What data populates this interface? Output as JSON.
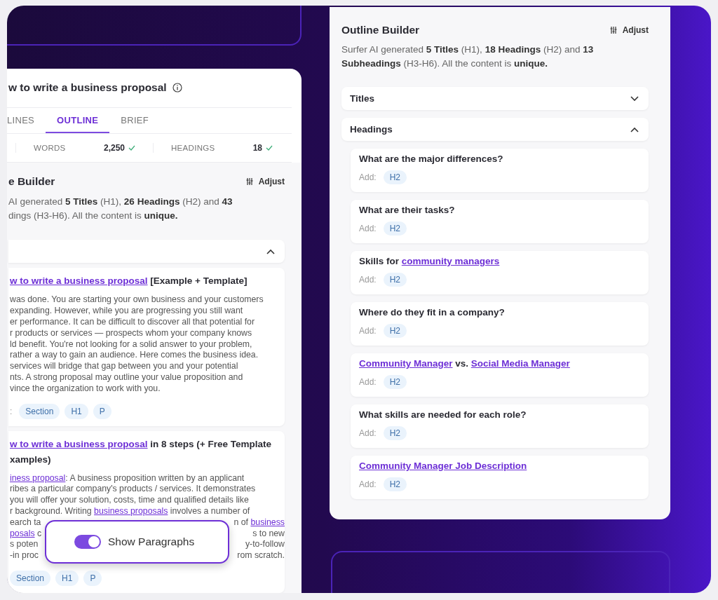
{
  "left_panel": {
    "title": "w to write a business proposal",
    "tabs": [
      {
        "label": "LINES",
        "selected": false
      },
      {
        "label": "OUTLINE",
        "selected": true
      },
      {
        "label": "BRIEF",
        "selected": false
      }
    ],
    "stats": [
      {
        "label": "WORDS",
        "value": "2,250",
        "met": true
      },
      {
        "label": "HEADINGS",
        "value": "18",
        "met": true
      }
    ],
    "builder": {
      "title": "e Builder",
      "action": "Adjust",
      "description_lines": [
        "AI generated **5 Titles** (H1), **26 Headings** (H2) and **43**",
        "dings (H3-H6). All the content is **unique.**"
      ]
    },
    "accordion": {
      "expanded": true
    },
    "sections": [
      {
        "title_lines": [
          [
            {
              "text": "w to write a business proposal",
              "link": true
            },
            {
              "text": " [Example + Template]"
            }
          ]
        ],
        "paragraph": [
          [
            [
              {
                "text": "was done. You are starting your own business and your customers"
              }
            ]
          ],
          [
            [
              {
                "text": "expanding. However, while you are progressing you still want"
              }
            ]
          ],
          [
            [
              {
                "text": "er performance. It can be difficult to discover all that potential for"
              }
            ]
          ],
          [
            [
              {
                "text": "r products or services — prospects whom your company knows"
              }
            ]
          ],
          [
            [
              {
                "text": "ld benefit. You're not looking for a solid answer to your problem,"
              }
            ]
          ],
          [
            [
              {
                "text": "rather a way to gain an audience. Here comes the business idea."
              }
            ]
          ],
          [
            [
              {
                "text": "services will bridge that gap between you and your potential"
              }
            ]
          ],
          [
            [
              {
                "text": "nts. A strong proposal may outline your value proposition and"
              }
            ]
          ],
          [
            [
              {
                "text": "vince the organization to work with you."
              }
            ]
          ]
        ],
        "tags_prefix": ":",
        "tags": [
          "Section",
          "H1",
          "P"
        ]
      },
      {
        "title_lines": [
          [
            {
              "text": "w to write a business proposal",
              "link": true
            },
            {
              "text": " in 8 steps (+ Free Template"
            }
          ],
          [
            {
              "text": "xamples)"
            }
          ]
        ],
        "paragraph": [
          [
            [
              {
                "text": "iness proposal",
                "link": true
              },
              {
                "text": ": A business proposition written by an applicant"
              }
            ]
          ],
          [
            [
              {
                "text": "ribes a particular company's products / services. It demonstrates"
              }
            ]
          ],
          [
            [
              {
                "text": "you will offer your solution, costs, time and qualified details like"
              }
            ]
          ],
          [
            [
              {
                "text": "r background. Writing "
              },
              {
                "text": "business proposals",
                "link": true
              },
              {
                "text": " involves a number of"
              }
            ]
          ],
          [
            [
              {
                "text": "earch ta"
              }
            ],
            [
              {
                "text": "n of "
              },
              {
                "text": "business",
                "link": true
              }
            ]
          ],
          [
            [
              {
                "text": "posals",
                "link": true
              },
              {
                "text": " c"
              }
            ],
            [
              {
                "text": "s to new"
              }
            ]
          ],
          [
            [
              {
                "text": "s poten"
              }
            ],
            [
              {
                "text": "y-to-follow"
              }
            ]
          ],
          [
            [
              {
                "text": "-in proc"
              }
            ],
            [
              {
                "text": "rom scratch."
              }
            ]
          ]
        ],
        "tags": [
          "Section",
          "H1",
          "P"
        ]
      }
    ]
  },
  "paragraph_toggle": {
    "label": "Show Paragraphs",
    "on": true
  },
  "right_panel": {
    "builder": {
      "title": "Outline Builder",
      "action": "Adjust",
      "description": "Surfer AI generated **5 Titles** (H1), **18 Headings** (H2) and **13 Subheadings** (H3-H6). All the content is **unique.**"
    },
    "accordions": [
      {
        "label": "Titles",
        "expanded": false
      },
      {
        "label": "Headings",
        "expanded": true,
        "items": [
          {
            "title": [
              {
                "text": "What are the major differences?"
              }
            ],
            "add_label": "Add:",
            "tags": [
              "H2"
            ]
          },
          {
            "title": [
              {
                "text": "What are their tasks?"
              }
            ],
            "add_label": "Add:",
            "tags": [
              "H2"
            ]
          },
          {
            "title": [
              {
                "text": "Skills for "
              },
              {
                "text": "community managers",
                "link": true
              }
            ],
            "add_label": "Add:",
            "tags": [
              "H2"
            ]
          },
          {
            "title": [
              {
                "text": "Where do they fit in a company?"
              }
            ],
            "add_label": "Add:",
            "tags": [
              "H2"
            ]
          },
          {
            "title": [
              {
                "text": "Community Manager",
                "link": true
              },
              {
                "text": " vs. "
              },
              {
                "text": "Social Media Manager",
                "link": true
              }
            ],
            "add_label": "Add:",
            "tags": [
              "H2"
            ]
          },
          {
            "title": [
              {
                "text": "What skills are needed for each role?"
              }
            ],
            "add_label": "Add:",
            "tags": [
              "H2"
            ]
          },
          {
            "title": [
              {
                "text": "Community Manager Job Description",
                "link": true
              }
            ],
            "add_label": "Add:",
            "tags": [
              "H2"
            ]
          }
        ]
      }
    ]
  }
}
